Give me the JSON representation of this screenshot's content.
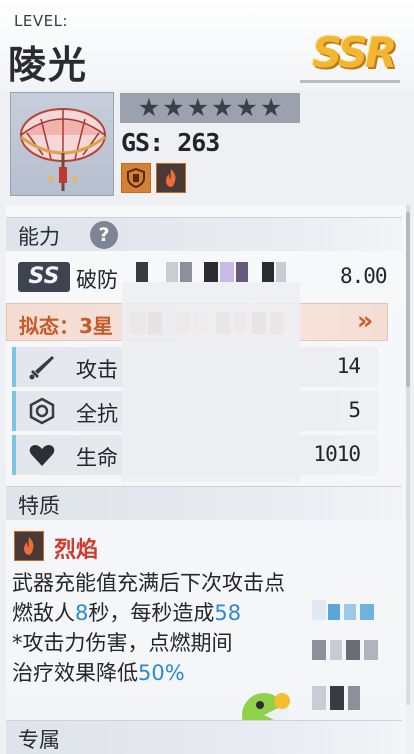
{
  "header": {
    "level_label": "LEVEL:",
    "character_name": "陵光",
    "rarity": "SSR"
  },
  "profile": {
    "stars": [
      "★",
      "★",
      "★",
      "★",
      "★",
      "★"
    ],
    "gear_score": "GS: 263",
    "element_badges": [
      "shield-element-icon",
      "flame-element-icon"
    ]
  },
  "ability_section": {
    "title": "能力",
    "help_label": "?",
    "skill": {
      "tier": "SS",
      "name": "破防",
      "value": "8.00"
    },
    "mimic": {
      "label": "拟态：3星",
      "arrow": "»"
    },
    "stats": [
      {
        "icon": "sword-icon",
        "label": "攻击",
        "value": "14"
      },
      {
        "icon": "shield-hex-icon",
        "label": "全抗",
        "value": "5"
      },
      {
        "icon": "heart-icon",
        "label": "生命",
        "value": "1010"
      }
    ]
  },
  "trait_section": {
    "title": "特质",
    "trait_name": "烈焰",
    "desc_line1": "武器充能值充满后下次攻击点",
    "desc_line2_a": "燃敌人",
    "desc_line2_hl1": "8",
    "desc_line2_b": "秒，每秒造成",
    "desc_line2_hl2": "58",
    "desc_line3": "*攻击力伤害，点燃期间",
    "desc_line4_a": "治疗效果降低",
    "desc_line4_hl": "50%"
  },
  "exclusive_section": {
    "title": "专属"
  },
  "colors": {
    "accent_blue": "#2b8ad2",
    "flame_red": "#d13a2a",
    "mimic_orange": "#c85a2a",
    "rarity_gold": "#f2b632"
  }
}
